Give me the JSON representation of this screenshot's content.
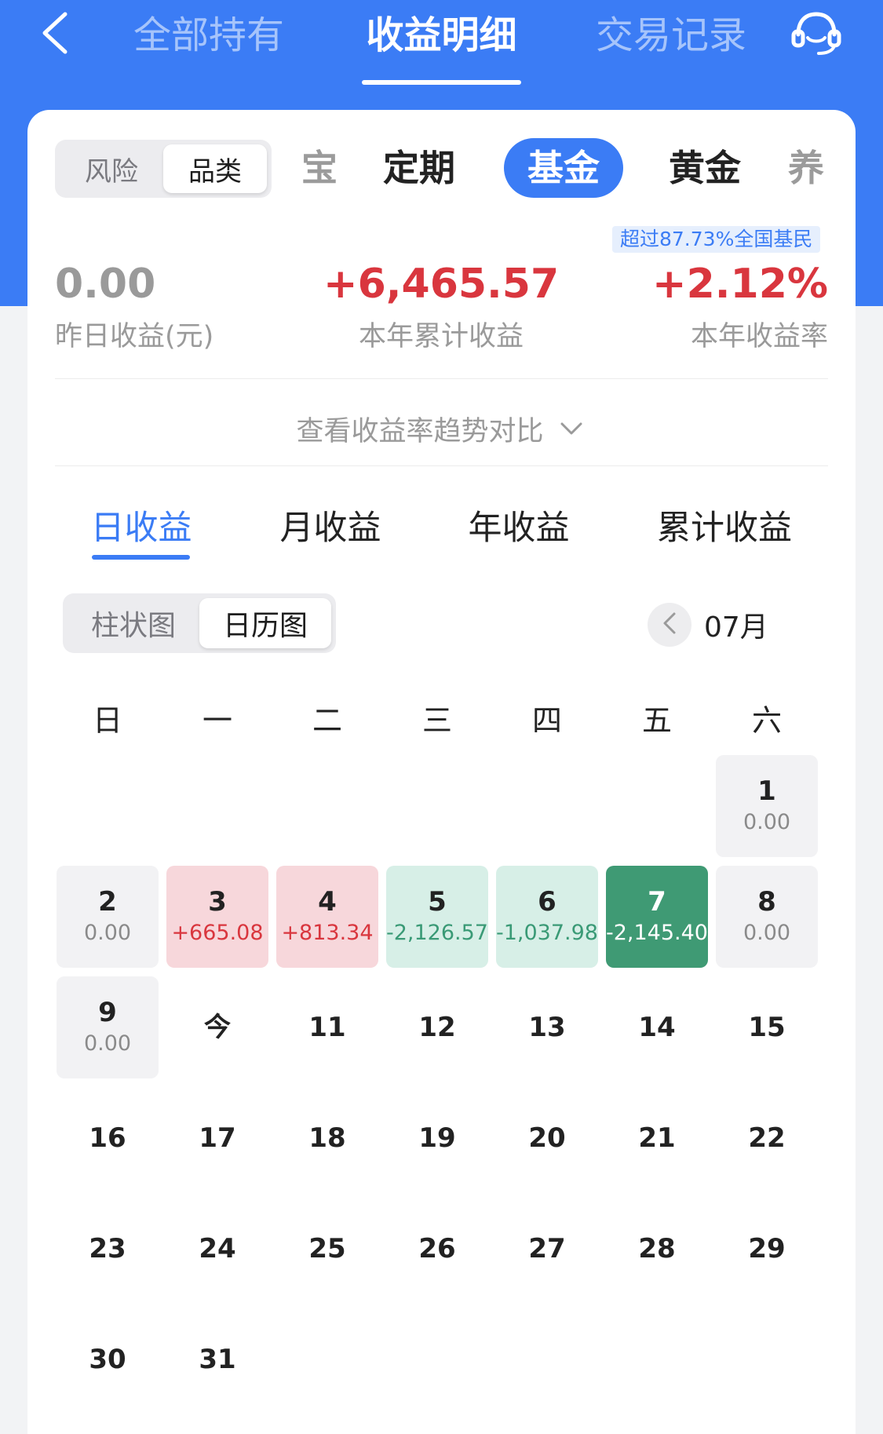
{
  "nav": {
    "tabs": [
      "全部持有",
      "收益明细",
      "交易记录"
    ],
    "active": "收益明细"
  },
  "filter": {
    "options": [
      "风险",
      "品类"
    ],
    "selected": "品类"
  },
  "categories": [
    "宝",
    "定期",
    "基金",
    "黄金",
    "养"
  ],
  "active_category": "基金",
  "badge": "超过87.73%全国基民",
  "stats": [
    {
      "value": "0.00",
      "label": "昨日收益(元)"
    },
    {
      "value": "+6,465.57",
      "label": "本年累计收益"
    },
    {
      "value": "+2.12%",
      "label": "本年收益率"
    }
  ],
  "trend_link": "查看收益率趋势对比",
  "range_tabs": [
    "日收益",
    "月收益",
    "年收益",
    "累计收益"
  ],
  "active_range": "日收益",
  "view_toggle": {
    "options": [
      "柱状图",
      "日历图"
    ],
    "selected": "日历图"
  },
  "month": "07月",
  "weekdays": [
    "日",
    "一",
    "二",
    "三",
    "四",
    "五",
    "六"
  ],
  "calendar": [
    {
      "day": "1",
      "value": "0.00",
      "status": "zero"
    },
    {
      "day": "2",
      "value": "0.00",
      "status": "zero"
    },
    {
      "day": "3",
      "value": "+665.08",
      "status": "pos"
    },
    {
      "day": "4",
      "value": "+813.34",
      "status": "pos"
    },
    {
      "day": "5",
      "value": "-2,126.57",
      "status": "negl"
    },
    {
      "day": "6",
      "value": "-1,037.98",
      "status": "negl"
    },
    {
      "day": "7",
      "value": "-2,145.40",
      "status": "negd"
    },
    {
      "day": "8",
      "value": "0.00",
      "status": "zero"
    },
    {
      "day": "9",
      "value": "0.00",
      "status": "zero"
    },
    {
      "day": "今",
      "value": "",
      "status": "plain"
    },
    {
      "day": "11",
      "value": "",
      "status": "plain"
    },
    {
      "day": "12",
      "value": "",
      "status": "plain"
    },
    {
      "day": "13",
      "value": "",
      "status": "plain"
    },
    {
      "day": "14",
      "value": "",
      "status": "plain"
    },
    {
      "day": "15",
      "value": "",
      "status": "plain"
    },
    {
      "day": "16",
      "value": "",
      "status": "plain"
    },
    {
      "day": "17",
      "value": "",
      "status": "plain"
    },
    {
      "day": "18",
      "value": "",
      "status": "plain"
    },
    {
      "day": "19",
      "value": "",
      "status": "plain"
    },
    {
      "day": "20",
      "value": "",
      "status": "plain"
    },
    {
      "day": "21",
      "value": "",
      "status": "plain"
    },
    {
      "day": "22",
      "value": "",
      "status": "plain"
    },
    {
      "day": "23",
      "value": "",
      "status": "plain"
    },
    {
      "day": "24",
      "value": "",
      "status": "plain"
    },
    {
      "day": "25",
      "value": "",
      "status": "plain"
    },
    {
      "day": "26",
      "value": "",
      "status": "plain"
    },
    {
      "day": "27",
      "value": "",
      "status": "plain"
    },
    {
      "day": "28",
      "value": "",
      "status": "plain"
    },
    {
      "day": "29",
      "value": "",
      "status": "plain"
    },
    {
      "day": "30",
      "value": "",
      "status": "plain"
    },
    {
      "day": "31",
      "value": "",
      "status": "plain"
    }
  ],
  "colors": {
    "brand": "#3b7cf5",
    "gain": "#d9363e",
    "loss": "#3a9a76",
    "loss_strong": "#3f9a74"
  },
  "icons": [
    "back-chevron-icon",
    "customer-service-icon",
    "chevron-down-icon",
    "chevron-left-icon"
  ]
}
